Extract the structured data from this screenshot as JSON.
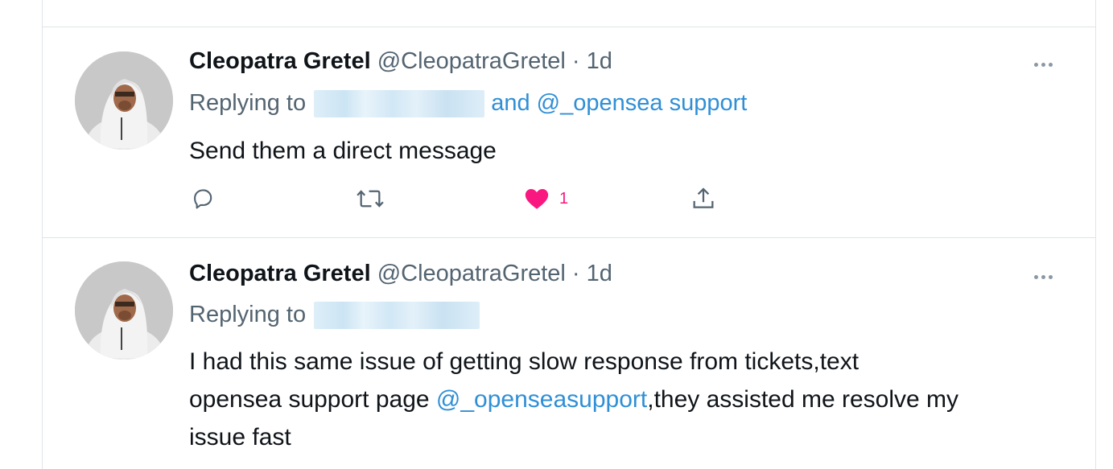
{
  "tweets": [
    {
      "name": "Cleopatra Gretel",
      "handle": "@CleopatraGretel",
      "separator": "·",
      "time": "1d",
      "replying_prefix": "Replying to",
      "replying_and": "and",
      "replying_mention": "@_opensea support",
      "text": "Send them a direct message",
      "like_count": "1"
    },
    {
      "name": "Cleopatra Gretel",
      "handle": "@CleopatraGretel",
      "separator": "·",
      "time": "1d",
      "replying_prefix": "Replying to",
      "text_line1": "I had this same issue of getting slow response from tickets,text",
      "text_line2_pre": "opensea support page ",
      "text_line2_mention": "@_openseasupport",
      "text_line2_post": ",they assisted me resolve my",
      "text_line3": "issue fast"
    }
  ],
  "icons": {
    "reply": "reply-icon",
    "retweet": "retweet-icon",
    "like": "heart-icon",
    "share": "share-icon",
    "more": "more-icon"
  },
  "colors": {
    "link": "#2f8fd6",
    "like": "#f91880",
    "muted": "#536471"
  }
}
